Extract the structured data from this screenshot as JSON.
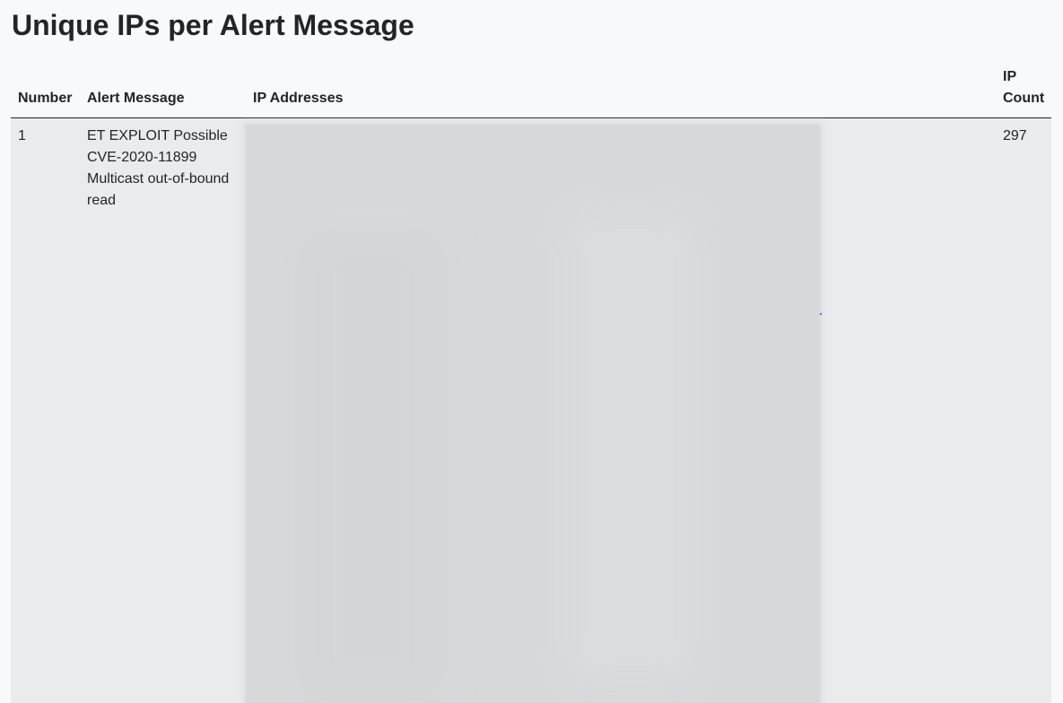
{
  "page": {
    "title": "Unique IPs per Alert Message"
  },
  "table": {
    "headers": {
      "number": "Number",
      "alert_message": "Alert Message",
      "ip_addresses": "IP Addresses",
      "ip_count": "IP Count"
    },
    "rows": [
      {
        "number": "1",
        "alert_message": "ET EXPLOIT Possible CVE-2020-11899 Multicast out-of-bound read",
        "ip_addresses": "",
        "ip_count": "297"
      }
    ]
  },
  "colors": {
    "background": "#f8f9fb",
    "row_background": "#eaebed",
    "text": "#212529",
    "redaction": "#d7d8da"
  }
}
